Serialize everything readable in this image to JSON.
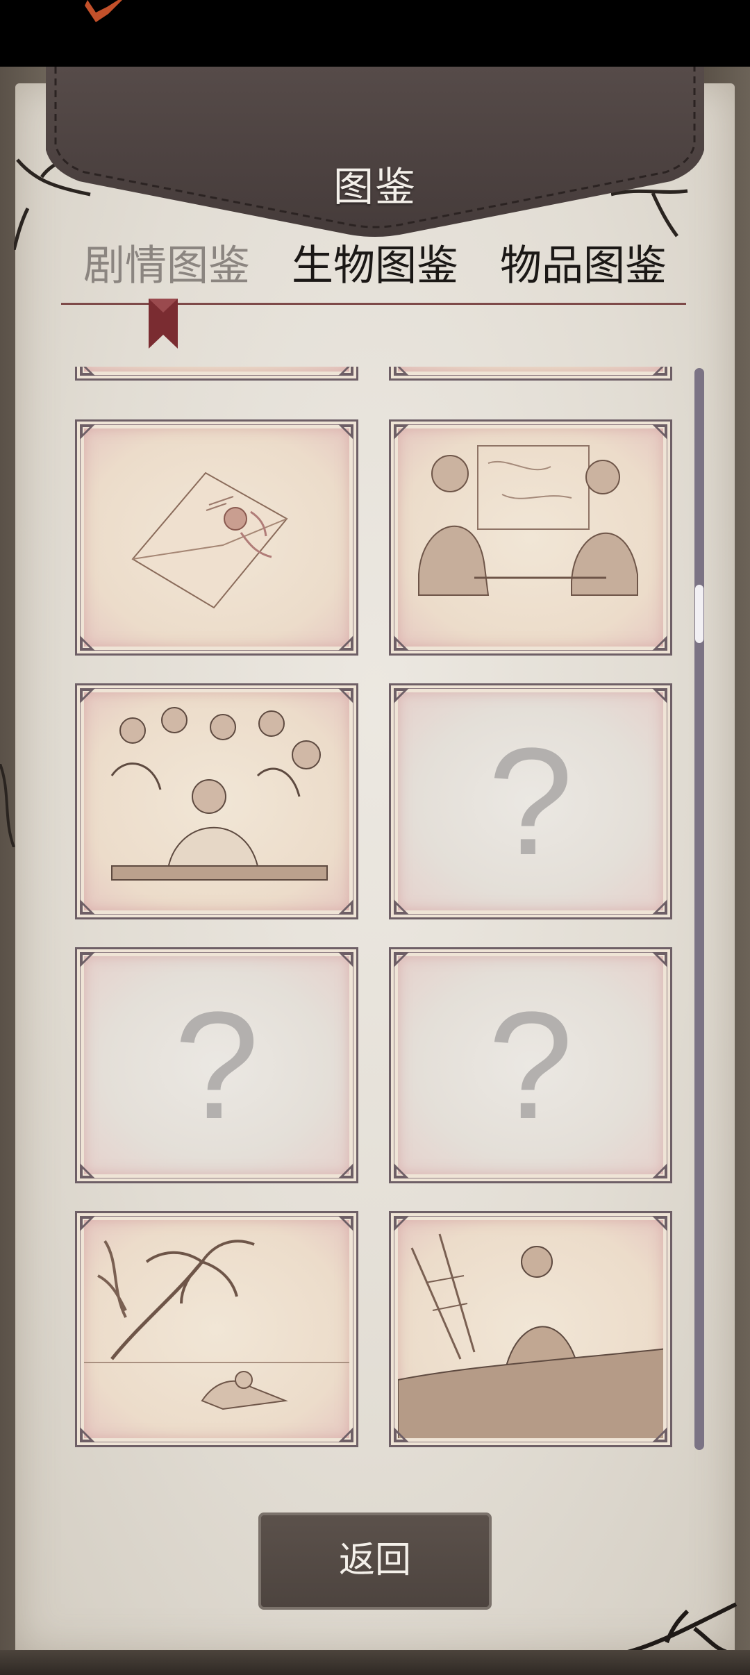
{
  "app": {
    "title": "图鉴"
  },
  "tabs": [
    {
      "label": "剧情图鉴",
      "active": true
    },
    {
      "label": "生物图鉴",
      "active": false
    },
    {
      "label": "物品图鉴",
      "active": false
    }
  ],
  "cards": [
    {
      "state": "partial",
      "image": "partial-scene-icon"
    },
    {
      "state": "partial",
      "image": "partial-scene-icon"
    },
    {
      "state": "unlocked",
      "image": "sealed-envelope-icon"
    },
    {
      "state": "unlocked",
      "image": "men-at-table-with-map-icon"
    },
    {
      "state": "unlocked",
      "image": "crowded-tavern-icon"
    },
    {
      "state": "locked",
      "symbol": "?"
    },
    {
      "state": "locked",
      "symbol": "?"
    },
    {
      "state": "locked",
      "symbol": "?"
    },
    {
      "state": "unlocked",
      "image": "castaway-on-beach-icon"
    },
    {
      "state": "unlocked",
      "image": "man-on-ship-deck-icon"
    }
  ],
  "footer": {
    "back_label": "返回"
  },
  "colors": {
    "accent": "#7e4a49",
    "leather": "#4e4443",
    "scrollbar": "#7b7384",
    "active_tab": "#8b8580",
    "inactive_tab": "#1b1816"
  }
}
